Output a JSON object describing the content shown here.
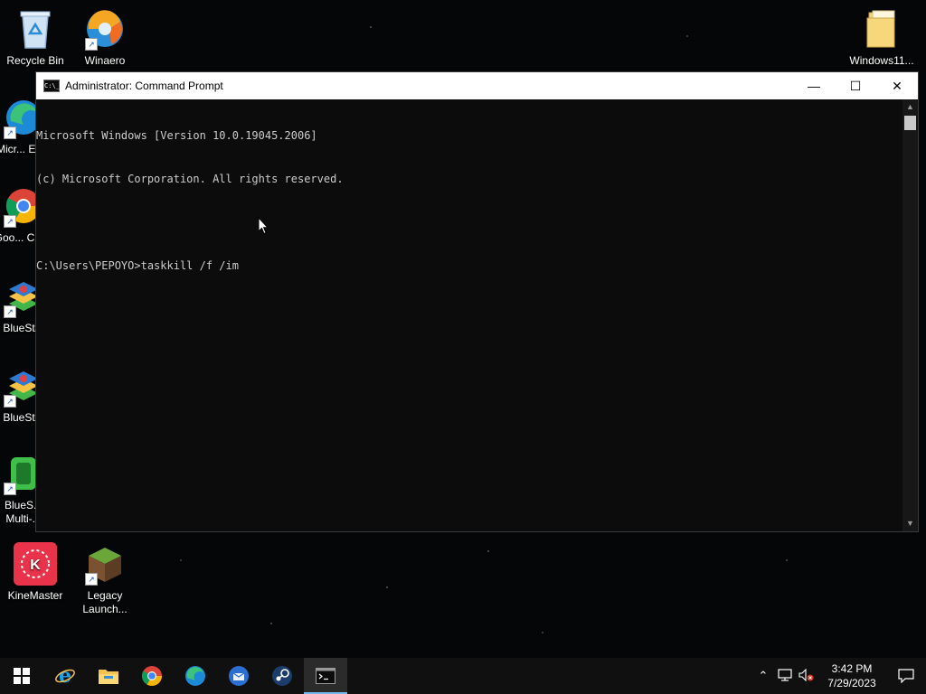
{
  "desktop": {
    "icons": [
      {
        "label": "Recycle Bin",
        "icon": "recycle-bin-icon"
      },
      {
        "label": "Winaero Tweaker",
        "icon": "winaero-icon"
      },
      {
        "label": "Windows11...",
        "icon": "folder-icon"
      },
      {
        "label": "Micr... Ed...",
        "icon": "edge-icon"
      },
      {
        "label": "Goo... Chr...",
        "icon": "chrome-icon"
      },
      {
        "label": "BlueSt...",
        "icon": "bluestacks-icon"
      },
      {
        "label": "BlueSt...",
        "icon": "bluestacks-x-icon"
      },
      {
        "label": "BlueS... Multi-...",
        "icon": "bluestacks-multi-icon"
      },
      {
        "label": "KineMaster",
        "icon": "kinemaster-icon"
      },
      {
        "label": "Legacy Launch...",
        "icon": "minecraft-icon"
      }
    ]
  },
  "window": {
    "title": "Administrator: Command Prompt",
    "app_icon_text": "C:\\_",
    "minimize": "—",
    "maximize": "☐",
    "close": "✕",
    "lines": [
      "Microsoft Windows [Version 10.0.19045.2006]",
      "(c) Microsoft Corporation. All rights reserved.",
      "",
      "C:\\Users\\PEPOYO>taskkill /f /im"
    ]
  },
  "taskbar": {
    "pinned": [
      "start-icon",
      "internet-explorer-icon",
      "file-explorer-icon",
      "chrome-icon",
      "edge-icon",
      "thunderbird-icon",
      "steam-icon",
      "command-prompt-icon"
    ],
    "time": "3:42 PM",
    "date": "7/29/2023"
  },
  "colors": {
    "console_bg": "#0c0c0c",
    "console_text": "#cccccc",
    "taskbar_bg": "#101010",
    "accent": "#76b9ed"
  }
}
